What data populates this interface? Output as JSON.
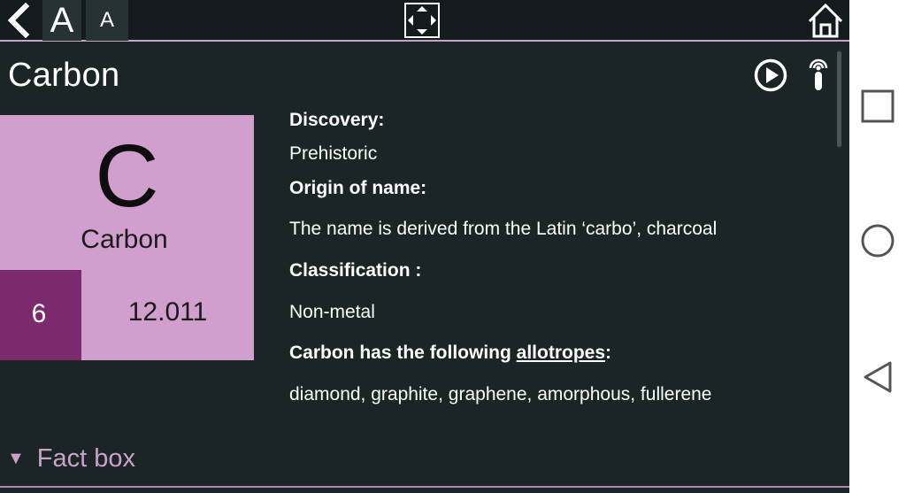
{
  "toolbar": {
    "font_increase_label": "A",
    "font_decrease_label": "A"
  },
  "element": {
    "title": "Carbon",
    "symbol": "C",
    "name": "Carbon",
    "atomic_number": "6",
    "atomic_mass": "12.011"
  },
  "details": {
    "discovery_label": "Discovery:",
    "discovery_value": "Prehistoric",
    "origin_label": "Origin of name:",
    "origin_value": "The name is derived from the Latin ‘carbo’, charcoal",
    "classification_label": "Classification :",
    "classification_value": "Non-metal",
    "allotropes_prefix": "Carbon has the following ",
    "allotropes_link": "allotropes",
    "allotropes_suffix": ":",
    "allotropes_value": "diamond, graphite, graphene, amorphous, fullerene"
  },
  "factbox": {
    "label": "Fact box"
  },
  "colors": {
    "background": "#1b2526",
    "tile": "#d09fce",
    "number_box": "#7c2a6e",
    "accent": "#c9a2ca"
  },
  "icons": [
    "back-icon",
    "fullscreen-icon",
    "home-icon",
    "play-icon",
    "audio-icon",
    "square-icon",
    "circle-icon",
    "triangle-icon"
  ]
}
